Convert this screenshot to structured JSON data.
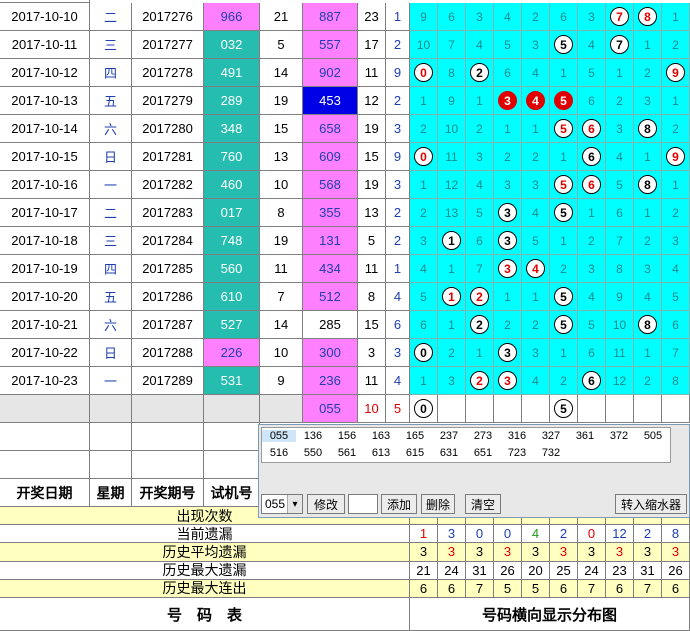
{
  "rows": [
    {
      "date": "2017-10-10",
      "week": "二",
      "issue": "2017276",
      "test": "966",
      "test_pink": true,
      "n1": "21",
      "draw": "887",
      "s": "23",
      "k": "1",
      "dist": [
        [
          "9",
          ""
        ],
        [
          "6",
          ""
        ],
        [
          "3",
          ""
        ],
        [
          "4",
          ""
        ],
        [
          "2",
          ""
        ],
        [
          "6",
          ""
        ],
        [
          "3",
          ""
        ],
        [
          "7",
          "wr"
        ],
        [
          "8",
          "wr"
        ],
        [
          "1",
          ""
        ]
      ]
    },
    {
      "date": "2017-10-11",
      "week": "三",
      "issue": "2017277",
      "test": "032",
      "test_pink": false,
      "n1": "5",
      "draw": "557",
      "s": "17",
      "k": "2",
      "dist": [
        [
          "10",
          ""
        ],
        [
          "7",
          ""
        ],
        [
          "4",
          ""
        ],
        [
          "5",
          ""
        ],
        [
          "3",
          ""
        ],
        [
          "5",
          "w"
        ],
        [
          "4",
          ""
        ],
        [
          "7",
          "w"
        ],
        [
          "1",
          ""
        ],
        [
          "2",
          ""
        ]
      ]
    },
    {
      "date": "2017-10-12",
      "week": "四",
      "issue": "2017278",
      "test": "491",
      "test_pink": false,
      "n1": "14",
      "draw": "902",
      "s": "11",
      "k": "9",
      "dist": [
        [
          "0",
          "wr"
        ],
        [
          "8",
          ""
        ],
        [
          "2",
          "w"
        ],
        [
          "6",
          ""
        ],
        [
          "4",
          ""
        ],
        [
          "1",
          ""
        ],
        [
          "5",
          ""
        ],
        [
          "1",
          ""
        ],
        [
          "2",
          ""
        ],
        [
          "9",
          "wr"
        ]
      ]
    },
    {
      "date": "2017-10-13",
      "week": "五",
      "issue": "2017279",
      "test": "289",
      "test_pink": false,
      "n1": "19",
      "draw": "453",
      "draw_blue": true,
      "s": "12",
      "k": "2",
      "dist": [
        [
          "1",
          ""
        ],
        [
          "9",
          ""
        ],
        [
          "1",
          ""
        ],
        [
          "3",
          "r"
        ],
        [
          "4",
          "r"
        ],
        [
          "5",
          "r"
        ],
        [
          "6",
          ""
        ],
        [
          "2",
          ""
        ],
        [
          "3",
          ""
        ],
        [
          "1",
          ""
        ]
      ]
    },
    {
      "date": "2017-10-14",
      "week": "六",
      "issue": "2017280",
      "test": "348",
      "test_pink": false,
      "n1": "15",
      "draw": "658",
      "s": "19",
      "k": "3",
      "dist": [
        [
          "2",
          ""
        ],
        [
          "10",
          ""
        ],
        [
          "2",
          ""
        ],
        [
          "1",
          ""
        ],
        [
          "1",
          ""
        ],
        [
          "5",
          "wr"
        ],
        [
          "6",
          "wr"
        ],
        [
          "3",
          ""
        ],
        [
          "8",
          "w"
        ],
        [
          "2",
          ""
        ]
      ]
    },
    {
      "date": "2017-10-15",
      "week": "日",
      "issue": "2017281",
      "test": "760",
      "test_pink": false,
      "n1": "13",
      "draw": "609",
      "s": "15",
      "k": "9",
      "dist": [
        [
          "0",
          "wr"
        ],
        [
          "11",
          ""
        ],
        [
          "3",
          ""
        ],
        [
          "2",
          ""
        ],
        [
          "2",
          ""
        ],
        [
          "1",
          ""
        ],
        [
          "6",
          "w"
        ],
        [
          "4",
          ""
        ],
        [
          "1",
          ""
        ],
        [
          "9",
          "wr"
        ]
      ]
    },
    {
      "date": "2017-10-16",
      "week": "一",
      "issue": "2017282",
      "test": "460",
      "test_pink": false,
      "n1": "10",
      "draw": "568",
      "s": "19",
      "k": "3",
      "dist": [
        [
          "1",
          ""
        ],
        [
          "12",
          ""
        ],
        [
          "4",
          ""
        ],
        [
          "3",
          ""
        ],
        [
          "3",
          ""
        ],
        [
          "5",
          "wr"
        ],
        [
          "6",
          "wr"
        ],
        [
          "5",
          ""
        ],
        [
          "8",
          "w"
        ],
        [
          "1",
          ""
        ]
      ]
    },
    {
      "date": "2017-10-17",
      "week": "二",
      "issue": "2017283",
      "test": "017",
      "test_pink": false,
      "n1": "8",
      "draw": "355",
      "s": "13",
      "k": "2",
      "dist": [
        [
          "2",
          ""
        ],
        [
          "13",
          ""
        ],
        [
          "5",
          ""
        ],
        [
          "3",
          "w"
        ],
        [
          "4",
          ""
        ],
        [
          "5",
          "w"
        ],
        [
          "1",
          ""
        ],
        [
          "6",
          ""
        ],
        [
          "1",
          ""
        ],
        [
          "2",
          ""
        ]
      ]
    },
    {
      "date": "2017-10-18",
      "week": "三",
      "issue": "2017284",
      "test": "748",
      "test_pink": false,
      "n1": "19",
      "draw": "131",
      "s": "5",
      "k": "2",
      "dist": [
        [
          "3",
          ""
        ],
        [
          "1",
          "w"
        ],
        [
          "6",
          ""
        ],
        [
          "3",
          "w"
        ],
        [
          "5",
          ""
        ],
        [
          "1",
          ""
        ],
        [
          "2",
          ""
        ],
        [
          "7",
          ""
        ],
        [
          "2",
          ""
        ],
        [
          "3",
          ""
        ]
      ]
    },
    {
      "date": "2017-10-19",
      "week": "四",
      "issue": "2017285",
      "test": "560",
      "test_pink": false,
      "n1": "11",
      "draw": "434",
      "s": "11",
      "k": "1",
      "dist": [
        [
          "4",
          ""
        ],
        [
          "1",
          ""
        ],
        [
          "7",
          ""
        ],
        [
          "3",
          "wr"
        ],
        [
          "4",
          "wr"
        ],
        [
          "2",
          ""
        ],
        [
          "3",
          ""
        ],
        [
          "8",
          ""
        ],
        [
          "3",
          ""
        ],
        [
          "4",
          ""
        ]
      ]
    },
    {
      "date": "2017-10-20",
      "week": "五",
      "issue": "2017286",
      "test": "610",
      "test_pink": false,
      "n1": "7",
      "draw": "512",
      "s": "8",
      "k": "4",
      "dist": [
        [
          "5",
          ""
        ],
        [
          "1",
          "wr"
        ],
        [
          "2",
          "wr"
        ],
        [
          "1",
          ""
        ],
        [
          "1",
          ""
        ],
        [
          "5",
          "w"
        ],
        [
          "4",
          ""
        ],
        [
          "9",
          ""
        ],
        [
          "4",
          ""
        ],
        [
          "5",
          ""
        ]
      ]
    },
    {
      "date": "2017-10-21",
      "week": "六",
      "issue": "2017287",
      "test": "527",
      "test_pink": false,
      "n1": "14",
      "draw": "285",
      "draw_white": true,
      "s": "15",
      "k": "6",
      "dist": [
        [
          "6",
          ""
        ],
        [
          "1",
          ""
        ],
        [
          "2",
          "w"
        ],
        [
          "2",
          ""
        ],
        [
          "2",
          ""
        ],
        [
          "5",
          "w"
        ],
        [
          "5",
          ""
        ],
        [
          "10",
          ""
        ],
        [
          "8",
          "w"
        ],
        [
          "6",
          ""
        ]
      ]
    },
    {
      "date": "2017-10-22",
      "week": "日",
      "issue": "2017288",
      "test": "226",
      "test_pink": true,
      "n1": "10",
      "draw": "300",
      "s": "3",
      "k": "3",
      "dist": [
        [
          "0",
          "w"
        ],
        [
          "2",
          ""
        ],
        [
          "1",
          ""
        ],
        [
          "3",
          "w"
        ],
        [
          "3",
          ""
        ],
        [
          "1",
          ""
        ],
        [
          "6",
          ""
        ],
        [
          "11",
          ""
        ],
        [
          "1",
          ""
        ],
        [
          "7",
          ""
        ]
      ]
    },
    {
      "date": "2017-10-23",
      "week": "一",
      "issue": "2017289",
      "test": "531",
      "test_pink": false,
      "n1": "9",
      "draw": "236",
      "s": "11",
      "k": "4",
      "dist": [
        [
          "1",
          ""
        ],
        [
          "3",
          ""
        ],
        [
          "2",
          "wr"
        ],
        [
          "3",
          "wr"
        ],
        [
          "4",
          ""
        ],
        [
          "2",
          ""
        ],
        [
          "6",
          "w"
        ],
        [
          "12",
          ""
        ],
        [
          "2",
          ""
        ],
        [
          "8",
          ""
        ]
      ]
    }
  ],
  "extra_row": {
    "draw": "055",
    "s": "10",
    "k": "5",
    "balls": [
      [
        "0",
        "w"
      ],
      [
        "",
        ""
      ],
      [
        "",
        ""
      ],
      [
        "",
        ""
      ],
      [
        "",
        ""
      ],
      [
        "5",
        "w"
      ],
      [
        "",
        ""
      ],
      [
        "",
        ""
      ],
      [
        "",
        ""
      ],
      [
        "",
        ""
      ]
    ]
  },
  "headers": {
    "date": "开奖日期",
    "week": "星期",
    "issue": "开奖期号",
    "test": "试机号"
  },
  "panel": {
    "row1": [
      "055",
      "136",
      "156",
      "163",
      "165",
      "237",
      "273",
      "316",
      "327",
      "361",
      "372",
      "505"
    ],
    "row2": [
      "516",
      "550",
      "561",
      "613",
      "615",
      "631",
      "651",
      "723",
      "732"
    ],
    "select_value": "055",
    "modify": "修改",
    "add": "添加",
    "delete": "删除",
    "clear": "清空",
    "transfer": "转入缩水器",
    "tiny_header": [
      "0",
      "1",
      "2",
      "3",
      "4",
      "5",
      "6",
      "7",
      "8",
      "9"
    ]
  },
  "stats": [
    {
      "label": "出现次数",
      "values": []
    },
    {
      "label": "当前遗漏",
      "values": [
        "1",
        "3",
        "0",
        "0",
        "4",
        "2",
        "0",
        "12",
        "2",
        "8"
      ],
      "colors": [
        "#e00000",
        "#1f3fb0",
        "#1f3fb0",
        "#1f3fb0",
        "#1f9a1f",
        "#1f3fb0",
        "#e00000",
        "#1f3fb0",
        "#1f3fb0",
        "#1f3fb0"
      ]
    },
    {
      "label": "历史平均遗漏",
      "values": [
        "3",
        "3",
        "3",
        "3",
        "3",
        "3",
        "3",
        "3",
        "3",
        "3"
      ],
      "colors": [
        "#000",
        "#e00000",
        "#000",
        "#e00000",
        "#000",
        "#e00000",
        "#000",
        "#e00000",
        "#000",
        "#e00000"
      ]
    },
    {
      "label": "历史最大遗漏",
      "values": [
        "21",
        "24",
        "31",
        "26",
        "20",
        "25",
        "24",
        "23",
        "31",
        "26"
      ]
    },
    {
      "label": "历史最大连出",
      "values": [
        "6",
        "6",
        "7",
        "5",
        "5",
        "6",
        "7",
        "6",
        "7",
        "6"
      ]
    }
  ],
  "footer": {
    "left": "号　码　表",
    "right": "号码横向显示分布图"
  },
  "colors": {
    "cyan": "#00ffff",
    "teal": "#26bdb1",
    "pink": "#ff80ff",
    "blue": "#0000e6",
    "yellow": "#ffffc0",
    "white_row": "#ffffff"
  }
}
